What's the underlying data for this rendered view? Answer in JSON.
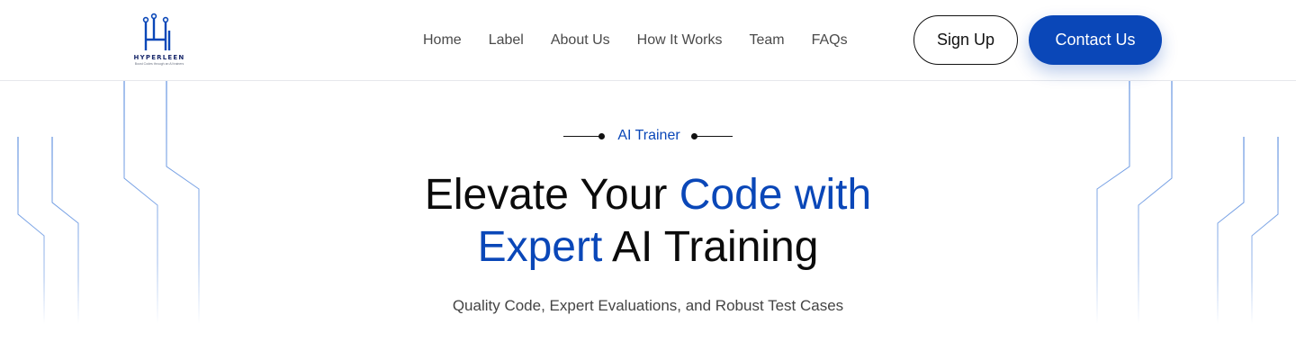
{
  "brand": {
    "name": "HYPERLEEN",
    "tagline": "Boost Codes through an AI trainers"
  },
  "nav": {
    "items": [
      "Home",
      "Label",
      "About Us",
      "How It Works",
      "Team",
      "FAQs"
    ]
  },
  "actions": {
    "signup_label": "Sign Up",
    "contact_label": "Contact Us"
  },
  "hero": {
    "eyebrow": "AI Trainer",
    "headline_line1_dark": "Elevate Your ",
    "headline_line1_blue": "Code with",
    "headline_line2_blue": "Expert",
    "headline_line2_dark": " AI Training",
    "subtitle": "Quality Code, Expert Evaluations, and Robust Test Cases"
  },
  "colors": {
    "accent": "#0a47b8",
    "text_dark": "#0b0b0b",
    "text_muted": "#444444",
    "divider": "#e6e8ec"
  }
}
